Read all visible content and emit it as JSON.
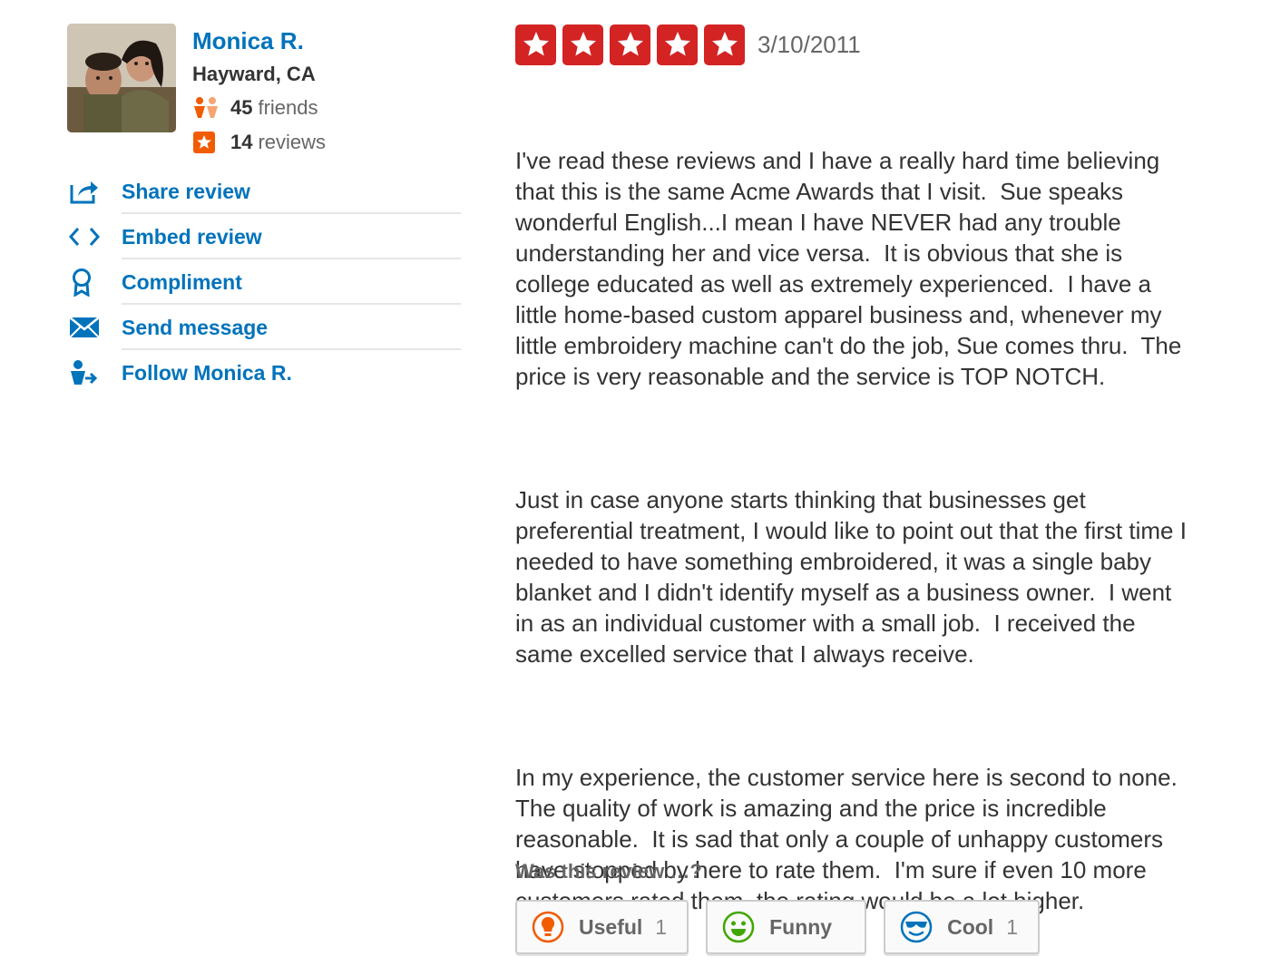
{
  "user": {
    "name": "Monica R.",
    "location": "Hayward, CA",
    "friends_count": "45",
    "friends_label": "friends",
    "reviews_count": "14",
    "reviews_label": "reviews"
  },
  "actions": [
    {
      "label": "Share review",
      "icon": "share-icon"
    },
    {
      "label": "Embed review",
      "icon": "embed-icon"
    },
    {
      "label": "Compliment",
      "icon": "compliment-icon"
    },
    {
      "label": "Send message",
      "icon": "envelope-icon"
    },
    {
      "label": "Follow Monica R.",
      "icon": "follow-icon"
    }
  ],
  "review": {
    "rating": 5,
    "date": "3/10/2011",
    "paragraphs": [
      "I've read these reviews and I have a really hard time believing that this is the same Acme Awards that I visit.  Sue speaks wonderful English...I mean I have NEVER had any trouble understanding her and vice versa.  It is obvious that she is college educated as well as extremely experienced.  I have a little home-based custom apparel business and, whenever my little embroidery machine can't do the job, Sue comes thru.  The price is very reasonable and the service is TOP NOTCH.",
      "Just in case anyone starts thinking that businesses get preferential treatment, I would like to point out that the first time I needed to have something embroidered, it was a single baby blanket and I didn't identify myself as a business owner.  I went in as an individual customer with a small job.  I received the same excelled service that I always receive.",
      "In my experience, the customer service here is second to none.  The quality of work is amazing and the price is incredible reasonable.  It is sad that only a couple of unhappy customers have stopped by here to rate them.  I'm sure if even 10 more customers rated them, the rating would be a lot higher."
    ]
  },
  "votes": {
    "title": "Was this review …?",
    "useful": {
      "label": "Useful",
      "count": "1"
    },
    "funny": {
      "label": "Funny",
      "count": ""
    },
    "cool": {
      "label": "Cool",
      "count": "1"
    }
  },
  "colors": {
    "link_blue": "#0073bb",
    "star_red": "#d32323",
    "useful_orange": "#f15c00",
    "funny_green": "#41a700",
    "cool_blue": "#0073bb"
  }
}
